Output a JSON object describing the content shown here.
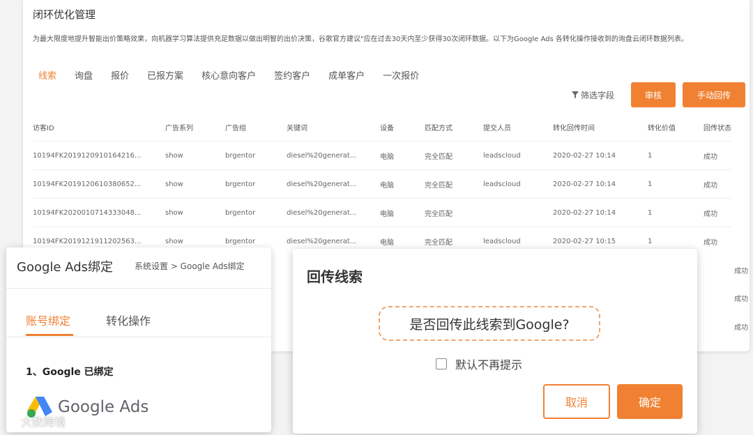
{
  "main": {
    "title": "闭环优化管理",
    "description": "为最大限度地提升智能出价策略效果，向机器学习算法提供充足数据以做出明智的出价决策，谷歌官方建议\"应在过去30天内至少获得30次闭环数据。以下为Google Ads 各转化操作接收到的询盘云闭环数据列表。",
    "tabs": [
      "线索",
      "询盘",
      "报价",
      "已报方案",
      "核心意向客户",
      "签约客户",
      "成单客户",
      "一次报价"
    ],
    "active_tab": 0,
    "filter_label": "筛选字段",
    "review_button": "审核",
    "manual_button": "手动回传",
    "columns": [
      "访客ID",
      "广告系列",
      "广告组",
      "关键词",
      "设备",
      "匹配方式",
      "提交人员",
      "转化回传时间",
      "转化价值",
      "回传状态"
    ],
    "rows": [
      [
        "10194FK2019120910164216...",
        "show",
        "brgentor",
        "diesel%20generat...",
        "电脑",
        "完全匹配",
        "leadscloud",
        "2020-02-27 10:14",
        "1",
        "成功"
      ],
      [
        "10194FK2019120610380652...",
        "show",
        "brgentor",
        "diesel%20generat...",
        "电脑",
        "完全匹配",
        "leadscloud",
        "2020-02-27 10:14",
        "1",
        "成功"
      ],
      [
        "10194FK2020010714333048...",
        "show",
        "brgentor",
        "diesel%20generat...",
        "电脑",
        "完全匹配",
        "",
        "2020-02-27 10:14",
        "1",
        "成功"
      ],
      [
        "10194FK2019121911202563...",
        "show",
        "brgentor",
        "diesel%20generat...",
        "电脑",
        "完全匹配",
        "leadscloud",
        "2020-02-27 10:15",
        "1",
        "成功"
      ]
    ],
    "hidden_statuses": [
      "成功",
      "成功",
      "成功"
    ]
  },
  "binding_panel": {
    "title": "Google Ads绑定",
    "breadcrumb": "系统设置 > Google Ads绑定",
    "tab_account": "账号绑定",
    "tab_conversion": "转化操作",
    "bound_text": "1、Google 已绑定",
    "google_ads_text": "Google Ads"
  },
  "dialog": {
    "title": "回传线索",
    "question": "是否回传此线索到Google?",
    "checkbox_label": "默认不再提示",
    "cancel": "取消",
    "confirm": "确定"
  },
  "watermark": "大数跨境",
  "colors": {
    "accent": "#f08132"
  }
}
